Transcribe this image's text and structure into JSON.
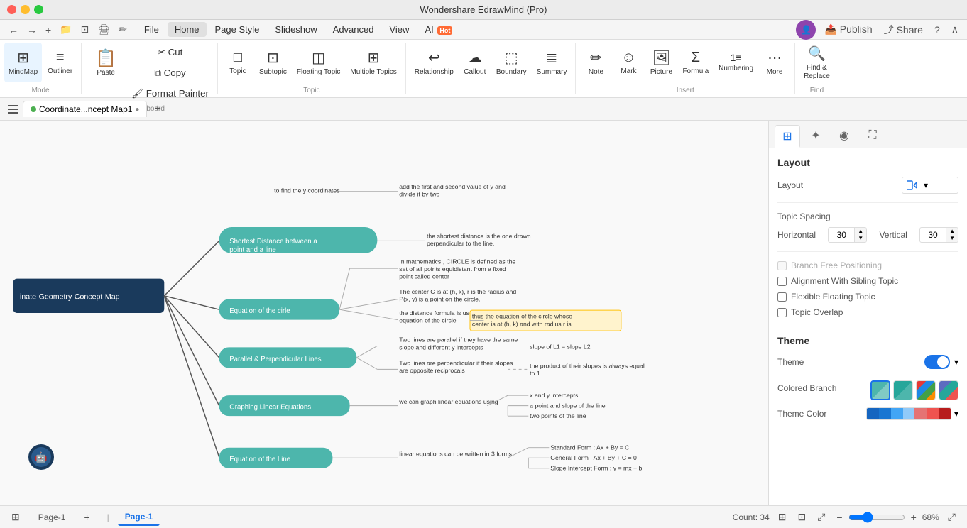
{
  "titleBar": {
    "title": "Wondershare EdrawMind (Pro)",
    "controls": [
      "close",
      "minimize",
      "maximize"
    ]
  },
  "menuBar": {
    "undoRedo": true,
    "items": [
      "File",
      "Home",
      "Page Style",
      "Slideshow",
      "Advanced",
      "View",
      "AI"
    ],
    "activeItem": "Home",
    "rightItems": [
      "Publish",
      "Share",
      "Help",
      "Collapse"
    ]
  },
  "ribbon": {
    "groups": [
      {
        "name": "Mode",
        "items": [
          {
            "id": "mindmap",
            "icon": "⊞",
            "label": "MindMap",
            "active": true
          },
          {
            "id": "outliner",
            "icon": "≡",
            "label": "Outliner",
            "active": false
          }
        ]
      },
      {
        "name": "Clipboard",
        "items": [
          {
            "id": "paste",
            "icon": "📋",
            "label": "Paste",
            "large": true
          },
          {
            "id": "cut",
            "icon": "✂",
            "label": "Cut"
          },
          {
            "id": "copy",
            "icon": "⧉",
            "label": "Copy"
          },
          {
            "id": "format-painter",
            "icon": "🖌",
            "label": "Format\nPainter"
          }
        ]
      },
      {
        "name": "Topic",
        "items": [
          {
            "id": "topic",
            "icon": "□",
            "label": "Topic"
          },
          {
            "id": "subtopic",
            "icon": "⊡",
            "label": "Subtopic"
          },
          {
            "id": "floating-topic",
            "icon": "◫",
            "label": "Floating\nTopic"
          },
          {
            "id": "multiple-topics",
            "icon": "⊞",
            "label": "Multiple\nTopics"
          }
        ]
      },
      {
        "name": "",
        "items": [
          {
            "id": "relationship",
            "icon": "↩",
            "label": "Relationship"
          },
          {
            "id": "callout",
            "icon": "☁",
            "label": "Callout"
          },
          {
            "id": "boundary",
            "icon": "⬚",
            "label": "Boundary"
          },
          {
            "id": "summary",
            "icon": "≣",
            "label": "Summary"
          }
        ]
      },
      {
        "name": "Insert",
        "items": [
          {
            "id": "note",
            "icon": "✏",
            "label": "Note"
          },
          {
            "id": "mark",
            "icon": "☺",
            "label": "Mark"
          },
          {
            "id": "picture",
            "icon": "🖼",
            "label": "Picture"
          },
          {
            "id": "formula",
            "icon": "Σ",
            "label": "Formula"
          },
          {
            "id": "numbering",
            "icon": "≡#",
            "label": "Numbering"
          },
          {
            "id": "more",
            "icon": "⋯",
            "label": "More"
          }
        ]
      },
      {
        "name": "Find",
        "items": [
          {
            "id": "find-replace",
            "icon": "🔍",
            "label": "Find &\nReplace"
          }
        ]
      }
    ]
  },
  "tabs": [
    {
      "id": "coordinate-map",
      "label": "Coordinate...ncept Map1",
      "active": true,
      "unsaved": true
    }
  ],
  "canvas": {
    "mainNode": {
      "label": "inate-Geometry-Concept-Map",
      "color": "#1a3a5c",
      "textColor": "white"
    },
    "topics": [
      {
        "id": "shortest-dist",
        "label": "Shortest Distance between a point and a line",
        "children": [
          {
            "label": "the shortest distance is the one drawn perpendicular to the line."
          }
        ]
      },
      {
        "id": "equation-circle",
        "label": "Equation of the cirle",
        "children": [
          {
            "label": "In mathematics , CIRCLE is defined as the set of all points equidistant from a fixed point called center"
          },
          {
            "label": "The center C is at (h, k), r is the radius and P(x, y) is a point on the circle."
          },
          {
            "label": "the distance formula is used to find the equation of the circle",
            "subchild": "thus the equation of the circle whose center is at (h, k) and with radius r is"
          }
        ]
      },
      {
        "id": "parallel-lines",
        "label": "Parallel & Perpendicular Lines",
        "children": [
          {
            "label": "Two lines are parallel if they have the same slope and different y intercepts",
            "subchild": "slope of L1 = slope L2"
          },
          {
            "label": "Two lines are perpendicular if their slopes are opposite reciprocals",
            "subchild": "the product of their slopes is always equal to 1"
          }
        ]
      },
      {
        "id": "graphing",
        "label": "Graphing Linear Equations",
        "children": [
          {
            "label": "we can graph linear equations using",
            "subchildren": [
              "x and y intercepts",
              "a point and slope of the line",
              "two points of the line"
            ]
          }
        ]
      },
      {
        "id": "equation-line",
        "label": "Equation of the Line",
        "children": [
          {
            "label": "linear equations can be written in 3 forms",
            "subchildren": [
              "Standard Form : Ax + By = C",
              "General Form : Ax + By + C = 0",
              "Slope  Intercept Form : y = mx + b"
            ]
          }
        ]
      }
    ]
  },
  "rightPanel": {
    "tabs": [
      {
        "id": "layout",
        "icon": "⊞",
        "active": true
      },
      {
        "id": "ai",
        "icon": "✦",
        "active": false
      },
      {
        "id": "location",
        "icon": "◉",
        "active": false
      },
      {
        "id": "settings",
        "icon": "⛶",
        "active": false
      }
    ],
    "layout": {
      "title": "Layout",
      "layoutLabel": "Layout",
      "layoutIcon": "⊢",
      "topicSpacing": "Topic Spacing",
      "horizontal": {
        "label": "Horizontal",
        "value": "30"
      },
      "vertical": {
        "label": "Vertical",
        "value": "30"
      },
      "checkboxes": [
        {
          "id": "branch-free",
          "label": "Branch Free Positioning",
          "checked": false,
          "disabled": true
        },
        {
          "id": "alignment",
          "label": "Alignment With Sibling Topic",
          "checked": false
        },
        {
          "id": "flexible",
          "label": "Flexible Floating Topic",
          "checked": false
        },
        {
          "id": "topic-overlap",
          "label": "Topic Overlap",
          "checked": false
        }
      ]
    },
    "theme": {
      "title": "Theme",
      "themeLabel": "Theme",
      "toggleOn": true,
      "coloredBranchLabel": "Colored Branch",
      "themeColorLabel": "Theme Color",
      "colorSwatches": [
        "#4db6ac",
        "#26a69a",
        "#009688",
        "#00897b",
        "#00796b"
      ],
      "themeColors": [
        "#1565c0",
        "#1976d2",
        "#42a5f5",
        "#90caf9",
        "#e57373",
        "#ef5350",
        "#c62828"
      ]
    }
  },
  "statusBar": {
    "pageIndicator": "⊞",
    "pages": [
      {
        "id": "page-1-tab",
        "label": "Page-1",
        "active": false
      }
    ],
    "addPage": "+",
    "activePage": "Page-1",
    "count": "Count: 34",
    "icons": [
      "⊞",
      "⊡",
      "⤢"
    ],
    "zoom": {
      "minus": "−",
      "slider": 68,
      "plus": "+",
      "value": "68%"
    },
    "expand": "⤢"
  },
  "ai": {
    "bubbleIcon": "🤖"
  }
}
